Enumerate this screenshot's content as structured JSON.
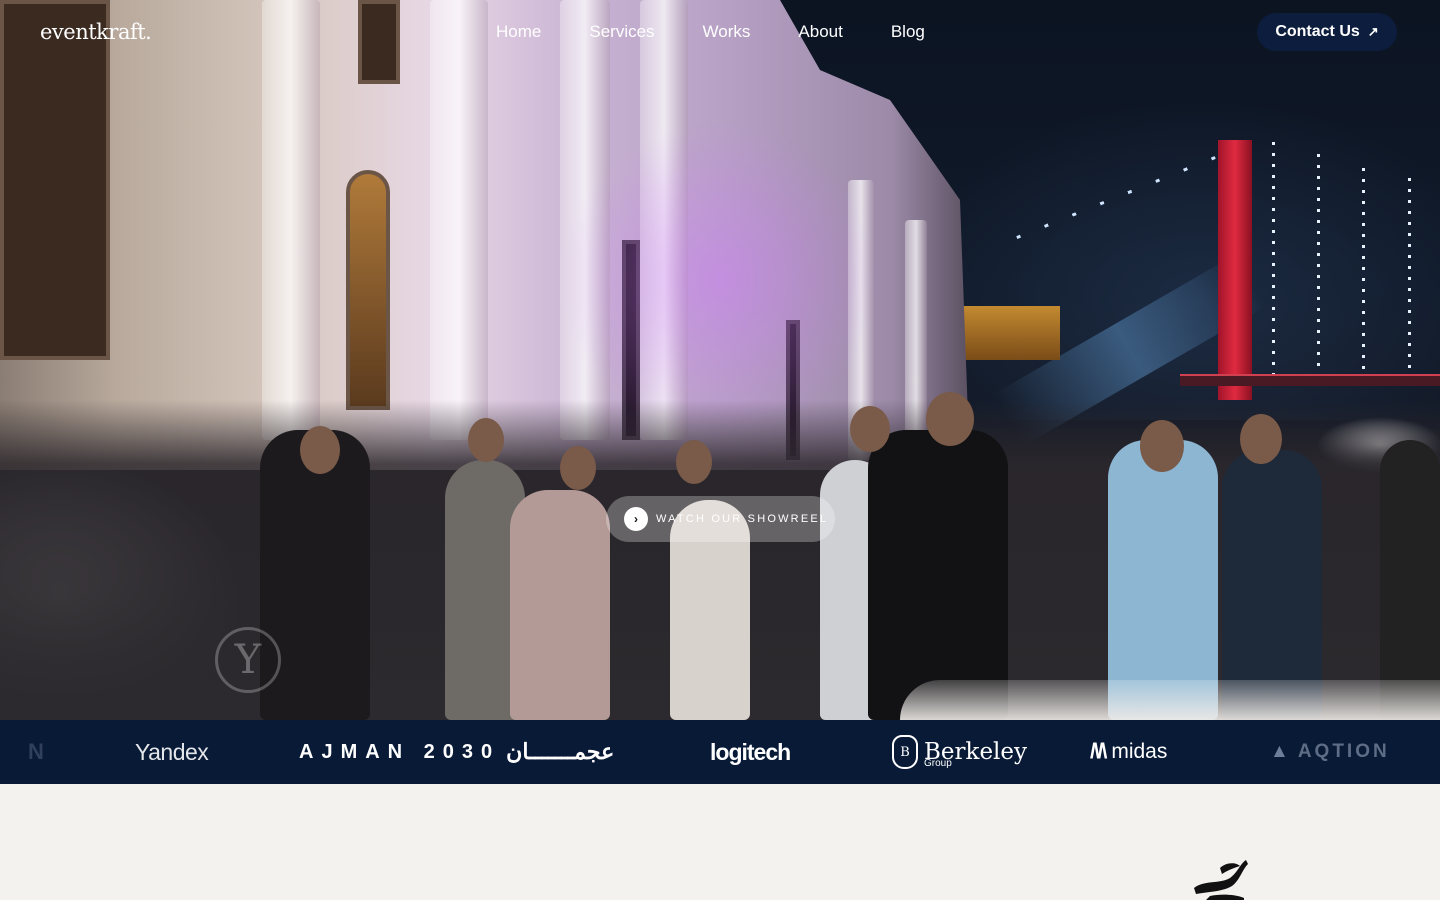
{
  "brand": {
    "logo_text": "eventkraft."
  },
  "nav": {
    "items": [
      {
        "label": "Home"
      },
      {
        "label": "Services"
      },
      {
        "label": "Works"
      },
      {
        "label": "About"
      },
      {
        "label": "Blog"
      }
    ],
    "contact_label": "Contact Us",
    "contact_icon": "arrow-up-right-icon"
  },
  "hero": {
    "showreel_label": "WATCH OUR SHOWREEL",
    "showreel_icon": "chevron-right-icon",
    "badge_letter": "Y"
  },
  "clients": {
    "partial_label": "N",
    "yandex": "Yandex",
    "ajman_latin": "AJMAN 2030",
    "ajman_arabic": "عجمـــــــان",
    "logitech": "logitech",
    "berkeley": "Berkeley",
    "berkeley_sub": "Group",
    "berkeley_crest": "B",
    "midas": "midas",
    "aqtion": "AQTION"
  },
  "colors": {
    "strip_bg": "#081a36",
    "contact_bg": "#0d1d3d",
    "page_bg": "#f3f2ef"
  }
}
